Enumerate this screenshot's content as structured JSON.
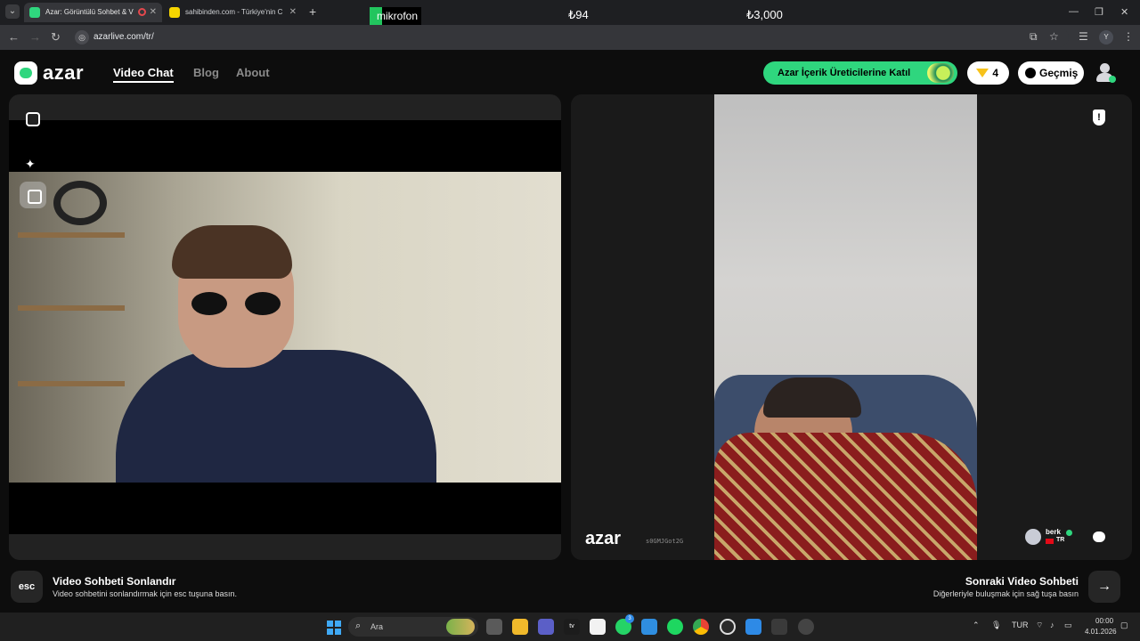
{
  "browser": {
    "tabs": [
      {
        "title": "Azar: Görüntülü Sohbet & V",
        "active": true
      },
      {
        "title": "sahibinden.com - Türkiye'nin C",
        "active": false
      }
    ],
    "new_tab": "+",
    "url": "azarlive.com/tr/",
    "profile_initial": "Y",
    "window_controls": [
      "—",
      "❐",
      "✕"
    ]
  },
  "stream_overlay": {
    "mic_label": "mikrofon",
    "amount_1": "₺94",
    "amount_2": "₺3,000"
  },
  "app": {
    "brand": "azar",
    "nav": [
      {
        "label": "Video Chat",
        "active": true
      },
      {
        "label": "Blog",
        "active": false
      },
      {
        "label": "About",
        "active": false
      }
    ],
    "creator_button": "Azar İçerik Üreticilerine Katıl",
    "gems": "4",
    "history_button": "Geçmiş",
    "accent": "#2fd67e"
  },
  "partner": {
    "watermark": "azar",
    "watermark_id": "s0GMJGot2G",
    "name": "berk",
    "country": "TR"
  },
  "controls": {
    "end": {
      "key": "esc",
      "title": "Video Sohbeti Sonlandır",
      "description": "Video sohbetini sonlandırmak için esc tuşuna basın."
    },
    "next": {
      "key": "→",
      "title": "Sonraki Video Sohbeti",
      "description": "Diğerleriyle buluşmak için sağ tuşa basın"
    }
  },
  "taskbar": {
    "search_placeholder": "Ara",
    "whatsapp_badge": "3",
    "language": "TUR",
    "time": "00:00",
    "date": "4.01.2026"
  }
}
